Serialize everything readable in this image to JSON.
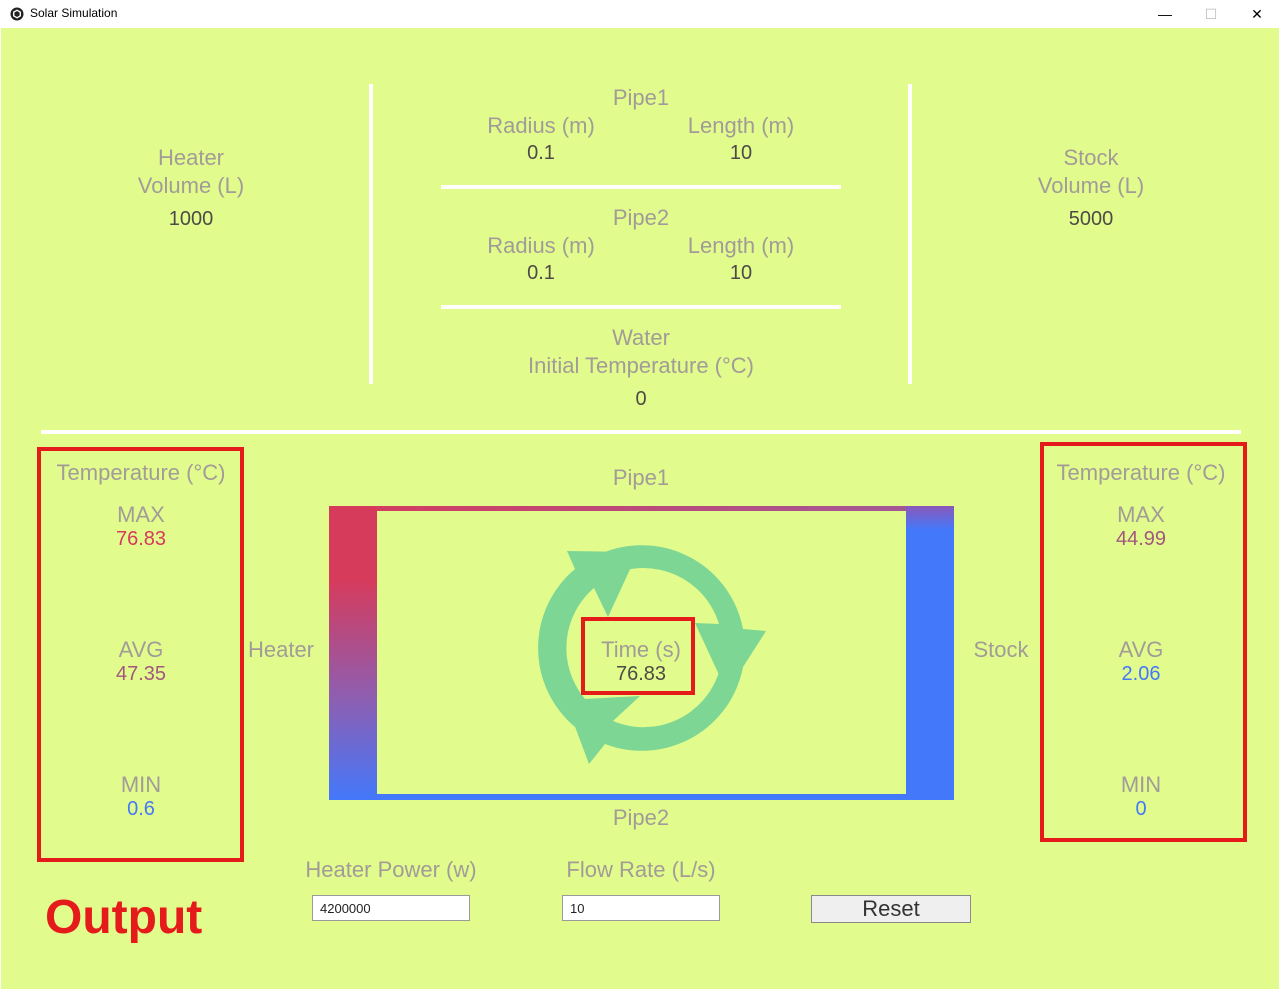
{
  "window": {
    "title": "Solar Simulation",
    "minimize": "—",
    "maximize": "☐",
    "close": "✕"
  },
  "config": {
    "heater": {
      "label_line1": "Heater",
      "label_line2": "Volume (L)",
      "value": "1000"
    },
    "pipe1": {
      "title": "Pipe1",
      "radius_label": "Radius (m)",
      "radius_value": "0.1",
      "length_label": "Length (m)",
      "length_value": "10"
    },
    "pipe2": {
      "title": "Pipe2",
      "radius_label": "Radius (m)",
      "radius_value": "0.1",
      "length_label": "Length (m)",
      "length_value": "10"
    },
    "water": {
      "label_line1": "Water",
      "label_line2": "Initial Temperature (°C)",
      "value": "0"
    },
    "stock": {
      "label_line1": "Stock",
      "label_line2": "Volume (L)",
      "value": "5000"
    }
  },
  "heater_temp": {
    "title": "Temperature (°C)",
    "max_label": "MAX",
    "max_value": "76.83",
    "avg_label": "AVG",
    "avg_value": "47.35",
    "min_label": "MIN",
    "min_value": "0.6"
  },
  "stock_temp": {
    "title": "Temperature (°C)",
    "max_label": "MAX",
    "max_value": "44.99",
    "avg_label": "AVG",
    "avg_value": "2.06",
    "min_label": "MIN",
    "min_value": "0"
  },
  "diagram": {
    "pipe1_label": "Pipe1",
    "pipe2_label": "Pipe2",
    "heater_label": "Heater",
    "stock_label": "Stock",
    "time_label": "Time (s)",
    "time_value": "76.83"
  },
  "controls": {
    "heater_power_label": "Heater Power (w)",
    "heater_power_value": "4200000",
    "flow_rate_label": "Flow Rate (L/s)",
    "flow_rate_value": "10",
    "reset_label": "Reset"
  },
  "annotation": {
    "output_label": "Output"
  },
  "colors": {
    "background": "#e1fc8c",
    "hot": "#d63b5c",
    "cold": "#4478fb",
    "warm": "#a2587e",
    "cycle_icon": "#7dd694",
    "annotation_red": "#e51b1b"
  }
}
